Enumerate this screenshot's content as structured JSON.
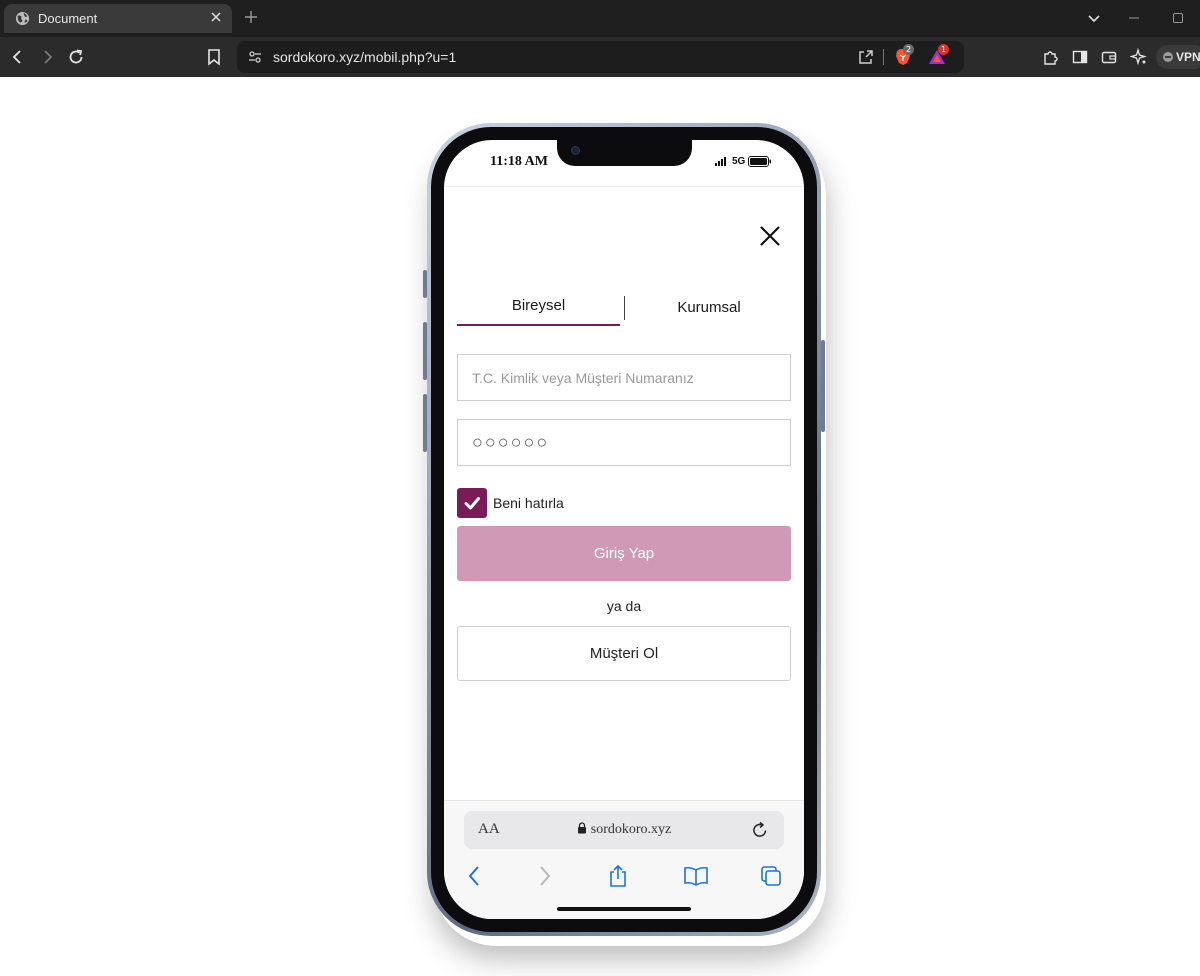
{
  "browser": {
    "tab": {
      "title": "Document",
      "favicon": "globe-icon"
    },
    "address_bar": {
      "url": "sordokoro.xyz/mobil.php?u=1"
    },
    "extensions": {
      "brave_shields_count": "2",
      "rewards_count": "1"
    },
    "vpn_label": "VPN"
  },
  "phone": {
    "status_bar": {
      "time": "11:18 AM",
      "network": "5G"
    },
    "login": {
      "tabs": [
        {
          "label": "Bireysel",
          "active": true
        },
        {
          "label": "Kurumsal",
          "active": false
        }
      ],
      "id_field": {
        "placeholder": "T.C. Kimlik veya Müşteri Numaranız",
        "value": ""
      },
      "password_field": {
        "value": "○○○○○○"
      },
      "remember_me": {
        "label": "Beni hatırla",
        "checked": true
      },
      "login_button": "Giriş Yap",
      "or_text": "ya da",
      "customer_button": "Müşteri Ol"
    },
    "safari": {
      "aa_label": "AA",
      "domain": "sordokoro.xyz"
    }
  },
  "colors": {
    "accent": "#7c1a57",
    "login_button_bg": "#d09ab7",
    "safari_blue": "#1a73e8"
  }
}
